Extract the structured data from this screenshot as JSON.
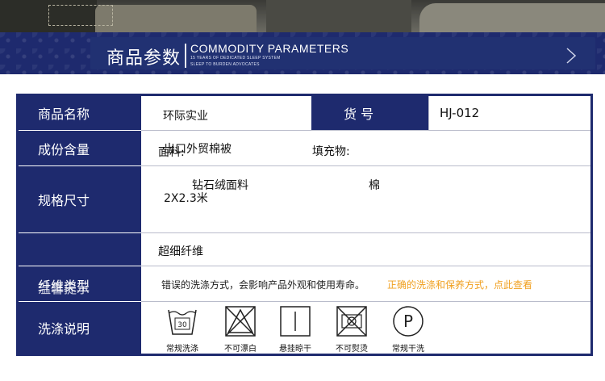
{
  "header": {
    "title_cn": "商品参数",
    "title_en": "COMMODITY PARAMETERS",
    "sub_line1": "15 YEARS OF DEDICATED SLEEP SYSTEM",
    "sub_line2": "SLEEP TO BURDEN ADVOCATES"
  },
  "table": {
    "rows": [
      {
        "label": "商品名称",
        "value": "环际实业",
        "extra_label": "货 号",
        "extra_value": "HJ-012"
      },
      {
        "label": "成份含量",
        "value_a": "面料:",
        "value_b": "出口外贸棉被",
        "value_c": "填充物:"
      },
      {
        "label": "规格尺寸",
        "value_a": "钻石绒面料",
        "value_b": "棉",
        "value_c": "2X2.3米"
      },
      {
        "label": "",
        "value": "超细纤维"
      },
      {
        "label": "纤维类型",
        "label_overlay": "温馨提示",
        "note_1": "错误的洗涤方式，会影响产品外观和使用寿命。",
        "note_2": "正确的洗涤和保养方式，点此查看"
      },
      {
        "label": "洗涤说明"
      }
    ],
    "care_icons": [
      {
        "icon": "wash-30-icon",
        "label": "常规洗涤",
        "number": "30"
      },
      {
        "icon": "no-bleach-icon",
        "label": "不可漂白"
      },
      {
        "icon": "hang-dry-icon",
        "label": "悬挂晾干"
      },
      {
        "icon": "no-iron-icon",
        "label": "不可熨烫"
      },
      {
        "icon": "dry-clean-icon",
        "label": "常规干洗",
        "letter": "P"
      }
    ]
  },
  "colors": {
    "navy": "#1e2a6e",
    "accent_orange": "#f0a020"
  }
}
